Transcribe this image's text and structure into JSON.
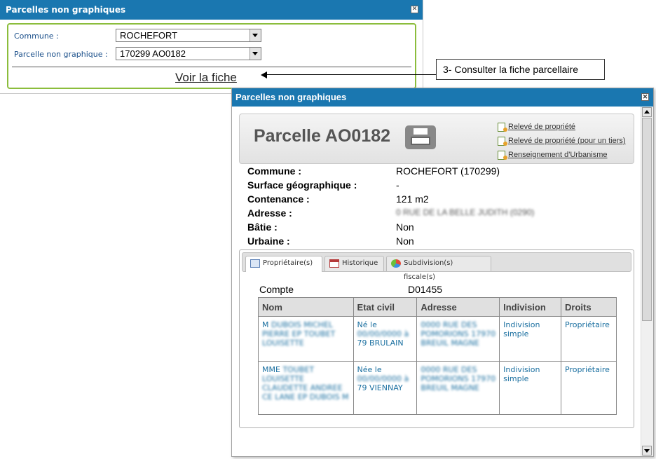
{
  "window1": {
    "title": "Parcelles non graphiques",
    "commune_label": "Commune :",
    "commune_value": "ROCHEFORT",
    "parcelle_label": "Parcelle non graphique :",
    "parcelle_value": "170299 AO0182",
    "voir_fiche": "Voir la fiche"
  },
  "callout": {
    "text": "3- Consulter la fiche parcellaire"
  },
  "window2": {
    "title": "Parcelles non graphiques",
    "parcel_title": "Parcelle AO0182",
    "links": [
      "Relevé de propriété",
      "Relevé de propriété (pour un tiers)",
      "Renseignement d'Urbanisme"
    ],
    "properties": [
      {
        "label": "Commune :",
        "value": "ROCHEFORT (170299)"
      },
      {
        "label": "Surface géographique :",
        "value": "-"
      },
      {
        "label": "Contenance :",
        "value": "121 m2"
      },
      {
        "label": "Adresse :",
        "value": "0 RUE DE LA BELLE JUDITH (0290)"
      },
      {
        "label": "Bâtie :",
        "value": "Non"
      },
      {
        "label": "Urbaine :",
        "value": "Non"
      }
    ],
    "tabs": [
      "Propriétaire(s)",
      "Historique",
      "Subdivision(s) fiscale(s)"
    ],
    "compte_label": "Compte",
    "compte_value": "D01455",
    "table": {
      "headers": [
        "Nom",
        "Etat civil",
        "Adresse",
        "Indivision",
        "Droits"
      ],
      "rows": [
        {
          "nom_prefix": "M",
          "nom_blur": "DUBOIS MICHEL PIERRE EP TOUBET LOUISETTE",
          "etat_prefix": "Né le",
          "etat_blur": "00/00/0000 à",
          "etat_suffix": "79 BRULAIN",
          "adresse_blur": "0000 RUE DES POMORIONS 17970 BREUIL MAGNE",
          "indivision": "Indivision simple",
          "droits": "Propriétaire"
        },
        {
          "nom_prefix": "MME",
          "nom_blur": "TOUBET LOUISETTE CLAUDETTE ANDREE CE LANE EP DUBOIS M",
          "etat_prefix": "Née le",
          "etat_blur": "00/00/0000 à",
          "etat_suffix": "79 VIENNAY",
          "adresse_blur": "0000 RUE DES POMORIONS 17970 BREUIL MAGNE",
          "indivision": "Indivision simple",
          "droits": "Propriétaire"
        }
      ]
    }
  }
}
